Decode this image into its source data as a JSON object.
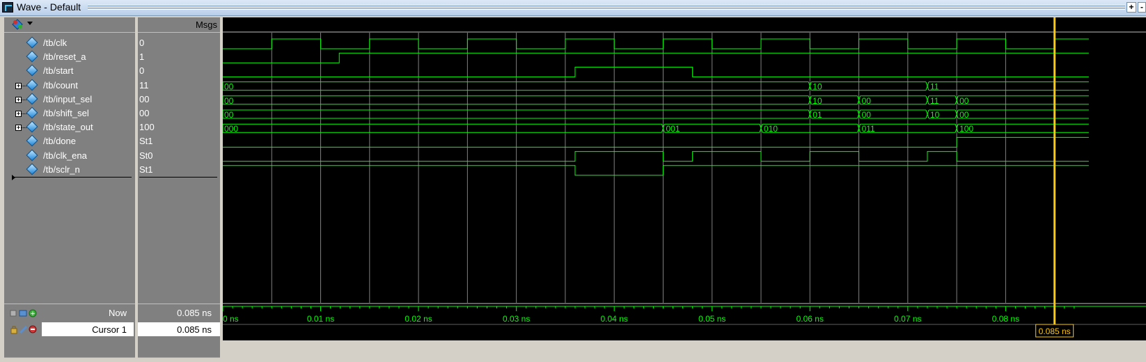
{
  "window": {
    "title": "Wave - Default",
    "buttons": [
      "+",
      "-"
    ]
  },
  "columns": {
    "msgs_header": "Msgs"
  },
  "signals": [
    {
      "name": "/tb/clk",
      "value": "0",
      "expandable": false,
      "type": "bit"
    },
    {
      "name": "/tb/reset_a",
      "value": "1",
      "expandable": false,
      "type": "bit"
    },
    {
      "name": "/tb/start",
      "value": "0",
      "expandable": false,
      "type": "bit"
    },
    {
      "name": "/tb/count",
      "value": "11",
      "expandable": true,
      "type": "bus"
    },
    {
      "name": "/tb/input_sel",
      "value": "00",
      "expandable": true,
      "type": "bus"
    },
    {
      "name": "/tb/shift_sel",
      "value": "00",
      "expandable": true,
      "type": "bus"
    },
    {
      "name": "/tb/state_out",
      "value": "100",
      "expandable": true,
      "type": "bus"
    },
    {
      "name": "/tb/done",
      "value": "St1",
      "expandable": false,
      "type": "bit"
    },
    {
      "name": "/tb/clk_ena",
      "value": "St0",
      "expandable": false,
      "type": "bit"
    },
    {
      "name": "/tb/sclr_n",
      "value": "St1",
      "expandable": false,
      "type": "bit"
    }
  ],
  "waves": {
    "time_range_ns": [
      0,
      0.0885
    ],
    "clk": {
      "period_ns": 0.01,
      "start_level": 0
    },
    "reset_a": [
      [
        0,
        0
      ],
      [
        0.0119,
        1
      ]
    ],
    "start": [
      [
        0,
        0
      ],
      [
        0.036,
        1
      ],
      [
        0.048,
        0
      ]
    ],
    "count": [
      [
        0,
        "00"
      ],
      [
        0.06,
        "10"
      ],
      [
        0.072,
        "11"
      ]
    ],
    "input_sel": [
      [
        0,
        "00"
      ],
      [
        0.06,
        "10"
      ],
      [
        0.065,
        "00"
      ],
      [
        0.072,
        "11"
      ],
      [
        0.075,
        "00"
      ]
    ],
    "shift_sel": [
      [
        0,
        "00"
      ],
      [
        0.06,
        "01"
      ],
      [
        0.065,
        "00"
      ],
      [
        0.072,
        "10"
      ],
      [
        0.075,
        "00"
      ]
    ],
    "state_out": [
      [
        0,
        "000"
      ],
      [
        0.045,
        "001"
      ],
      [
        0.055,
        "010"
      ],
      [
        0.065,
        "011"
      ],
      [
        0.075,
        "100"
      ]
    ],
    "done": [
      [
        0,
        0
      ],
      [
        0.075,
        1
      ]
    ],
    "clk_ena": [
      [
        0,
        0
      ],
      [
        0.036,
        1
      ],
      [
        0.045,
        0
      ],
      [
        0.048,
        1
      ],
      [
        0.055,
        0
      ],
      [
        0.06,
        1
      ],
      [
        0.065,
        0
      ],
      [
        0.072,
        1
      ],
      [
        0.075,
        0
      ]
    ],
    "sclr_n": [
      [
        0,
        1
      ],
      [
        0.036,
        0
      ],
      [
        0.045,
        1
      ]
    ]
  },
  "timeline": {
    "ticks": [
      "0 ns",
      "0.01 ns",
      "0.02 ns",
      "0.03 ns",
      "0.04 ns",
      "0.05 ns",
      "0.06 ns",
      "0.07 ns",
      "0.08 ns"
    ],
    "now_label": "Now",
    "now_value": "0.085 ns",
    "cursor_label": "Cursor 1",
    "cursor_value": "0.085 ns",
    "cursor_time_ns": 0.085,
    "cursor_flag": "0.085 ns"
  },
  "colors": {
    "wave": "#00ff00",
    "cursor": "#ffc800",
    "grid": "#808080",
    "background": "#000000",
    "axis_text": "#00ff00"
  }
}
